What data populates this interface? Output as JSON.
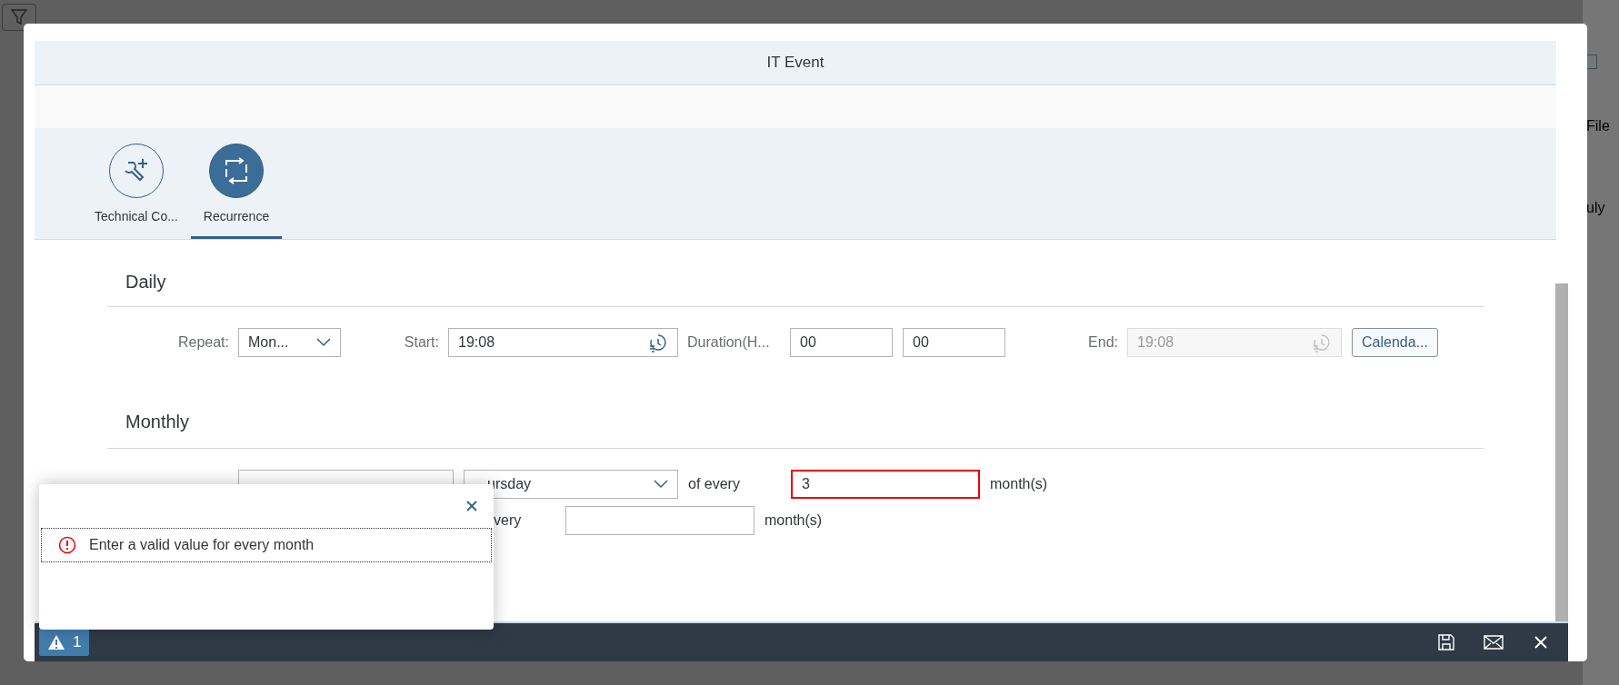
{
  "background": {
    "texts": [
      "File",
      "uly"
    ]
  },
  "dialog": {
    "title": "IT Event"
  },
  "tabs": [
    {
      "label": "Technical Co...",
      "kind": "tools",
      "selected": false
    },
    {
      "label": "Recurrence",
      "kind": "recurrence",
      "selected": true
    }
  ],
  "daily": {
    "title": "Daily",
    "repeat_label": "Repeat:",
    "repeat_value": "Mon...",
    "start_label": "Start:",
    "start_value": "19:08",
    "duration_label": "Duration(H...",
    "hours": "00",
    "minutes": "00",
    "end_label": "End:",
    "end_value": "19:08",
    "end_disabled": true,
    "calendar_button": "Calenda..."
  },
  "monthly": {
    "title": "Monthly",
    "weekday_value": "ursday",
    "of_every_label": "of every",
    "every_value": "3",
    "every_error": true,
    "months_label": "month(s)",
    "second_label": "very",
    "second_months_label": "month(s)"
  },
  "popup": {
    "message": "Enter a valid value for every month"
  },
  "footer": {
    "warning_count": "1"
  }
}
